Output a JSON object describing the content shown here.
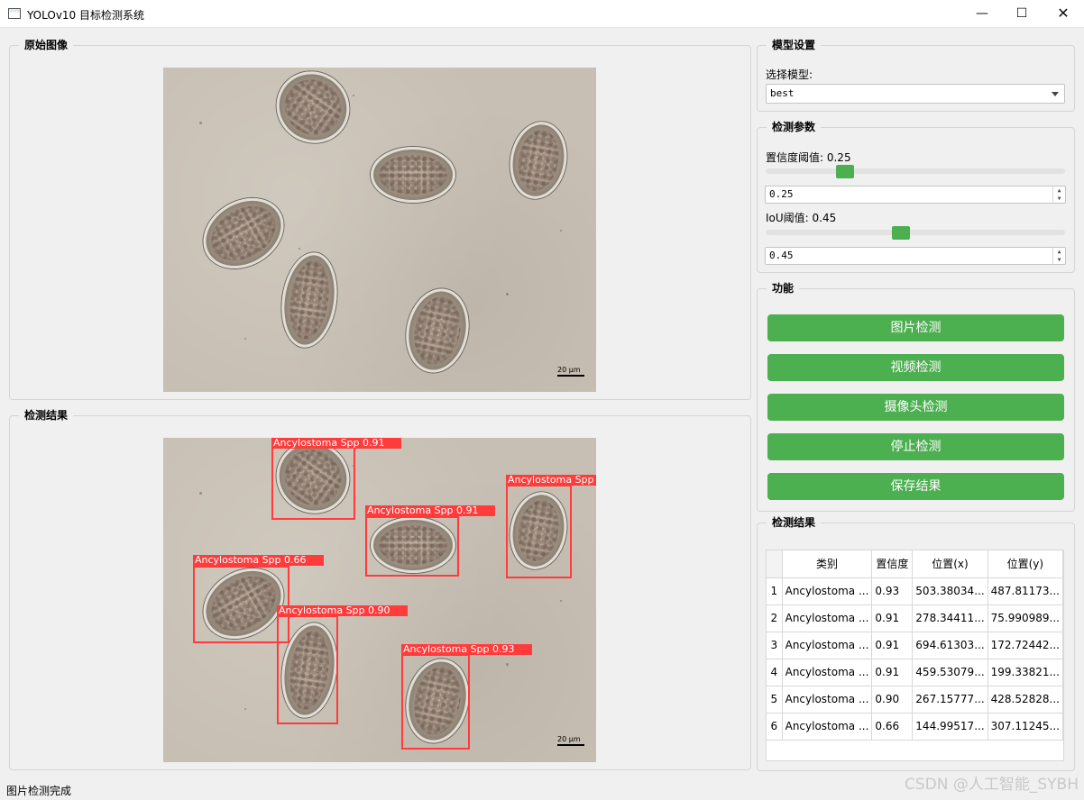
{
  "window": {
    "title": "YOLOv10 目标检测系统",
    "min": "—",
    "max": "☐",
    "close": "✕"
  },
  "original": {
    "title": "原始图像",
    "scale": "20 μm"
  },
  "result": {
    "title": "检测结果",
    "scale": "20 μm",
    "labels": [
      "Ancylostoma Spp 0.91",
      "Ancylostoma Spp 0.91",
      "Ancylostoma Spp",
      "Ancylostoma Spp 0.66",
      "Ancylostoma Spp 0.90",
      "Ancylostoma Spp 0.93"
    ]
  },
  "model": {
    "title": "模型设置",
    "select_label": "选择模型:",
    "selected": "best"
  },
  "params": {
    "title": "检测参数",
    "conf_label": "置信度阈值: 0.25",
    "conf_value": "0.25",
    "conf_fraction": 0.25,
    "iou_label": "IoU阈值: 0.45",
    "iou_value": "0.45",
    "iou_fraction": 0.45
  },
  "functions": {
    "title": "功能",
    "image_detect": "图片检测",
    "video_detect": "视频检测",
    "camera_detect": "摄像头检测",
    "stop_detect": "停止检测",
    "save_results": "保存结果"
  },
  "results_table": {
    "title": "检测结果",
    "headers": [
      "类别",
      "置信度",
      "位置(x)",
      "位置(y)"
    ],
    "rows": [
      {
        "num": "1",
        "cls": "Ancylostoma ...",
        "conf": "0.93",
        "x": "503.38034...",
        "y": "487.81173..."
      },
      {
        "num": "2",
        "cls": "Ancylostoma ...",
        "conf": "0.91",
        "x": "278.34411...",
        "y": "75.990989..."
      },
      {
        "num": "3",
        "cls": "Ancylostoma ...",
        "conf": "0.91",
        "x": "694.61303...",
        "y": "172.72442..."
      },
      {
        "num": "4",
        "cls": "Ancylostoma ...",
        "conf": "0.91",
        "x": "459.53079...",
        "y": "199.33821..."
      },
      {
        "num": "5",
        "cls": "Ancylostoma ...",
        "conf": "0.90",
        "x": "267.15777...",
        "y": "428.52828..."
      },
      {
        "num": "6",
        "cls": "Ancylostoma ...",
        "conf": "0.66",
        "x": "144.99517...",
        "y": "307.11245..."
      }
    ]
  },
  "status": "图片检测完成",
  "watermark": "CSDN @人工智能_SYBH",
  "colors": {
    "accent": "#4caf50",
    "detection": "#ff3b3b"
  }
}
